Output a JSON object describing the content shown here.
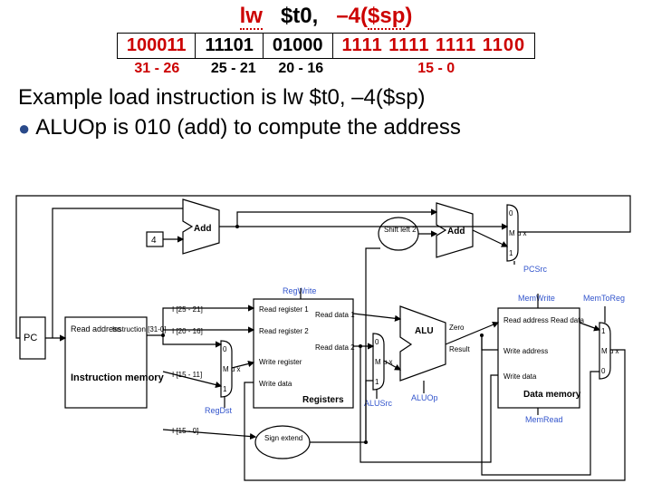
{
  "title": {
    "mnemonic": "lw",
    "reg": "$t0",
    "comma": ",",
    "neg": "–4",
    "lparen": "(",
    "sp": "$sp",
    "rparen": ")"
  },
  "encoding": {
    "opcode": "100011",
    "rs": "11101",
    "rt": "01000",
    "imm": "1111 1111 1111 1100",
    "bits": {
      "op": "31 - 26",
      "rs": "25 - 21",
      "rt": "20 - 16",
      "imm": "15 - 0"
    }
  },
  "explain_line": "Example load instruction is lw $t0, –4($sp)",
  "bullet_line": "ALUOp is 010 (add) to compute the address",
  "diagram": {
    "pc": "PC",
    "instr_mem_top": "Read address",
    "instr_mem_name": "Instruction memory",
    "instr_bus": "Instruction [31-0]",
    "add1": "Add",
    "four": "4",
    "shiftleft": "Shift left 2",
    "add2": "Add",
    "pcsrc": "PCSrc",
    "regwrite": "RegWrite",
    "regdst": "RegDst",
    "rf_rr1": "Read register 1",
    "rf_rr2": "Read register 2",
    "rf_wr": "Write register",
    "rf_wd": "Write data",
    "rf_rd1": "Read data 1",
    "rf_rd2": "Read data 2",
    "rf_name": "Registers",
    "i25_21": "I [25 - 21]",
    "i20_16": "I [20 - 16]",
    "i15_11": "I [15 - 11]",
    "i15_0": "I [15 - 0]",
    "alusrc": "ALUSrc",
    "aluop": "ALUOp",
    "alu": "ALU",
    "alu_zero": "Zero",
    "alu_result": "Result",
    "signext": "Sign extend",
    "memwrite": "MemWrite",
    "memread": "MemRead",
    "memtoreg": "MemToReg",
    "mem_ra": "Read address",
    "mem_wa": "Write address",
    "mem_wd": "Write data",
    "mem_rd": "Read data",
    "mem_name": "Data memory",
    "mux_label_long": "M u x",
    "mux0": "0",
    "mux1": "1"
  }
}
